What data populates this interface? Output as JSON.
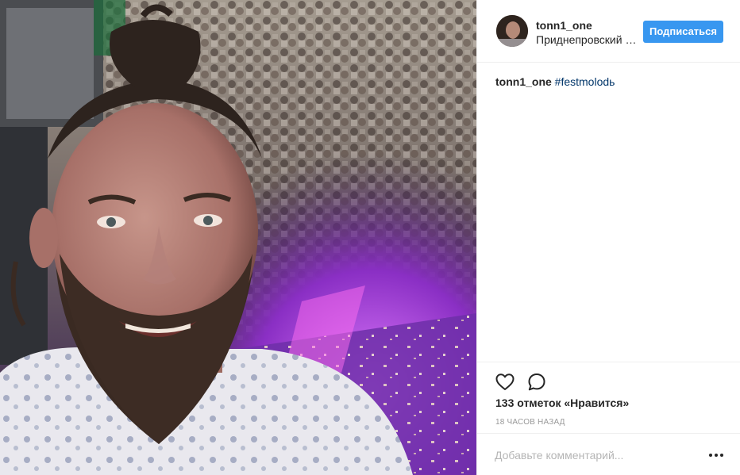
{
  "post": {
    "username": "tonn1_one",
    "location": "Приднепровский парк",
    "follow_label": "Подписаться",
    "caption": {
      "username": "tonn1_one",
      "hashtag": "#festmolodь"
    },
    "likes_text": "133 отметок «Нравится»",
    "timestamp": "18 часов назад",
    "comment_placeholder": "Добавьте комментарий...",
    "icons": {
      "like": "heart-icon",
      "comment": "comment-icon",
      "more": "more-options-icon"
    }
  },
  "colors": {
    "follow_button": "#3897f0",
    "hashtag": "#003569",
    "divider": "#efefef",
    "muted_text": "#999999"
  }
}
